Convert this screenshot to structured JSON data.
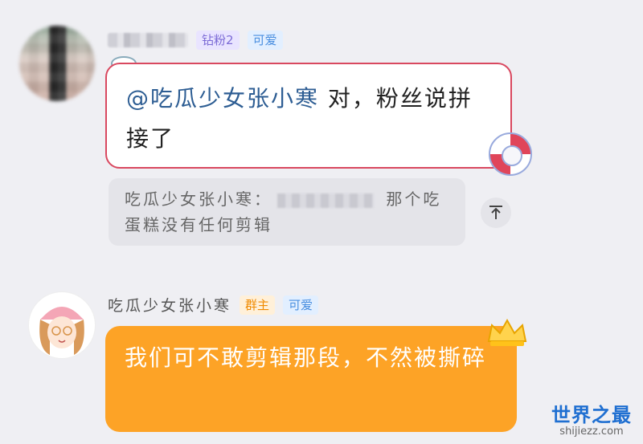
{
  "message_1": {
    "badges": [
      "钻粉2",
      "可爱"
    ],
    "mention": "@吃瓜少女张小寒",
    "text": " 对，粉丝说拼接了"
  },
  "quote": {
    "prefix": "吃瓜少女张小寒：",
    "suffix": " 那个吃蛋糕没有任何剪辑"
  },
  "message_2": {
    "sender": "吃瓜少女张小寒",
    "badges": [
      "群主",
      "可爱"
    ],
    "text": "我们可不敢剪辑那段，不然被撕碎"
  },
  "watermark": {
    "main": "世界之最",
    "sub": "shijiezz.com"
  },
  "icons": {
    "back_to_top": "arrow-up-icon",
    "bubble_deco_1": "life-ring-icon",
    "bubble_deco_2": "crown-icon"
  },
  "colors": {
    "bubble_orange": "#fda326",
    "bubble_border": "#d9485f",
    "badge_purple": "#7c6bd6",
    "badge_blue": "#4a8fe0",
    "badge_orange": "#f08a00",
    "watermark_blue": "#1f6fd1"
  }
}
